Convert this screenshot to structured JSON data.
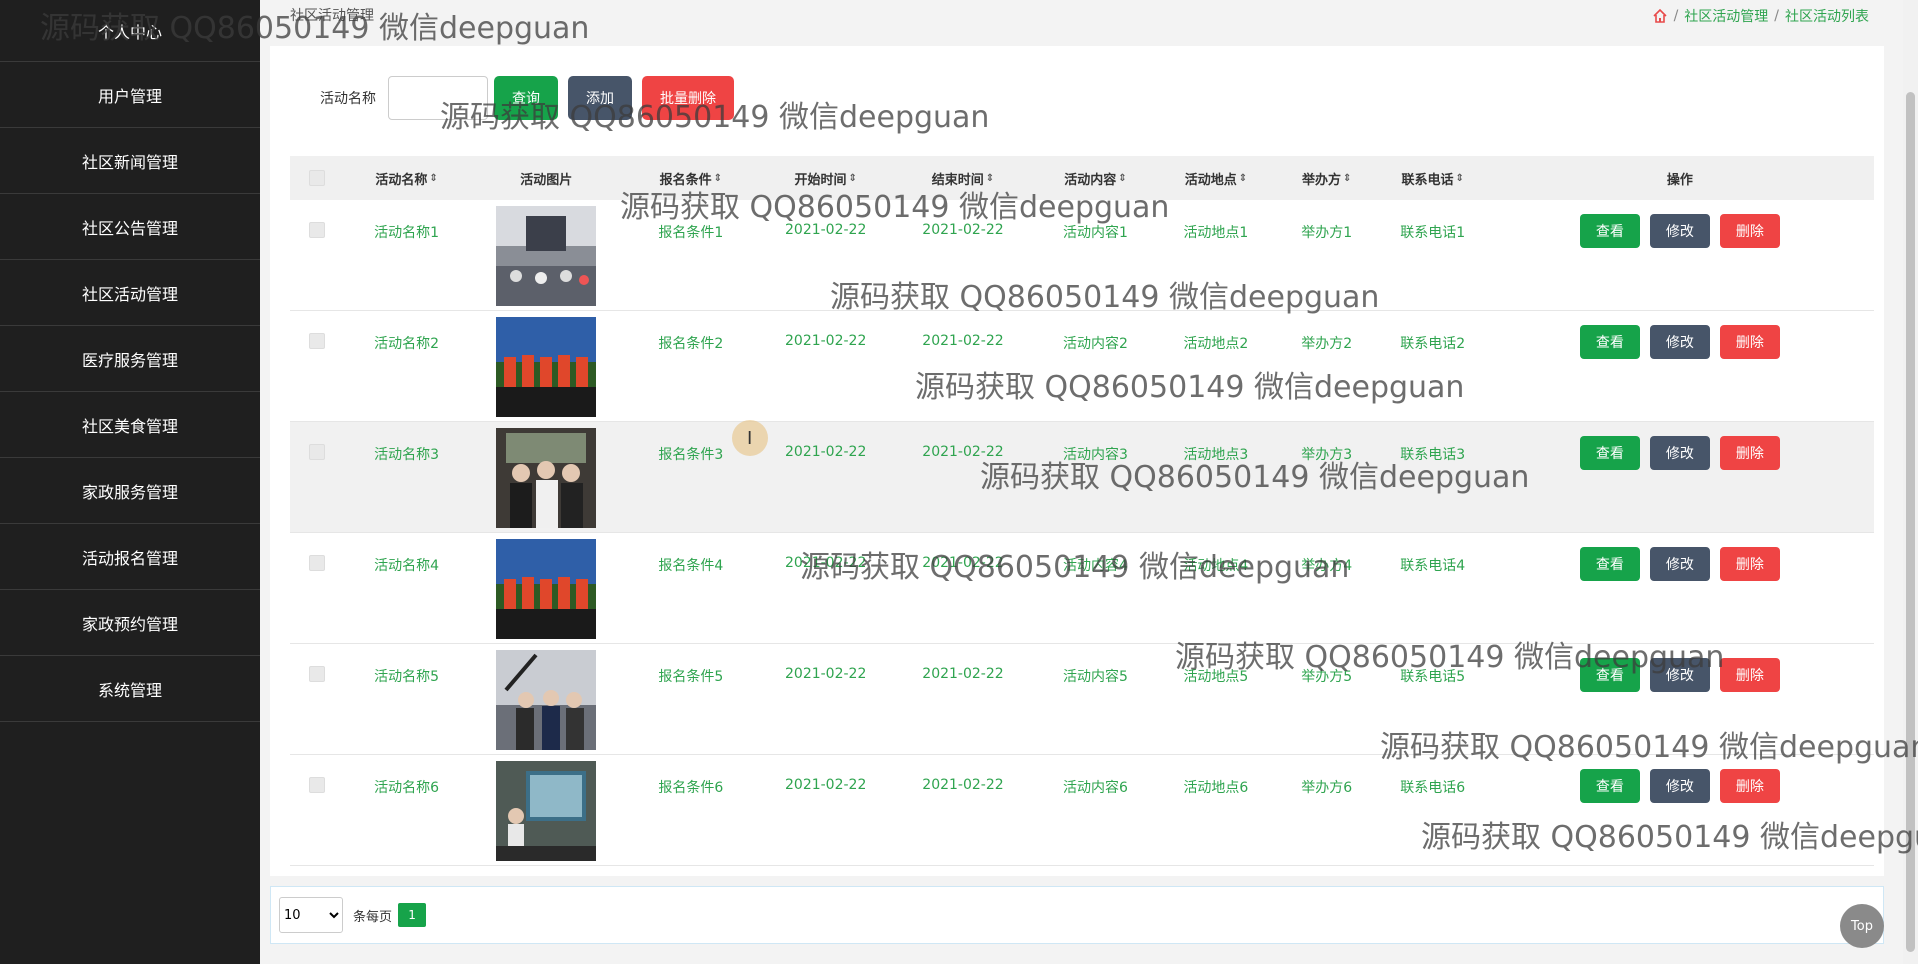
{
  "sidebar": {
    "items": [
      {
        "label": "个人中心"
      },
      {
        "label": "用户管理"
      },
      {
        "label": "社区新闻管理"
      },
      {
        "label": "社区公告管理"
      },
      {
        "label": "社区活动管理"
      },
      {
        "label": "医疗服务管理"
      },
      {
        "label": "社区美食管理"
      },
      {
        "label": "家政服务管理"
      },
      {
        "label": "活动报名管理"
      },
      {
        "label": "家政预约管理"
      },
      {
        "label": "系统管理"
      }
    ]
  },
  "header": {
    "title": "社区活动管理",
    "breadcrumb": [
      "社区活动管理",
      "社区活动列表"
    ],
    "breadcrumb_sep": "/"
  },
  "search": {
    "label": "活动名称",
    "value": "",
    "query_btn": "查询",
    "add_btn": "添加",
    "batch_delete_btn": "批量删除"
  },
  "table": {
    "columns": [
      "活动名称",
      "活动图片",
      "报名条件",
      "开始时间",
      "结束时间",
      "活动内容",
      "活动地点",
      "举办方",
      "联系电话",
      "操作"
    ],
    "sort_icon": "⇕",
    "rows": [
      {
        "name": "活动名称1",
        "cond": "报名条件1",
        "start": "2021-02-22",
        "end": "2021-02-22",
        "content": "活动内容1",
        "place": "活动地点1",
        "org": "举办方1",
        "phone": "联系电话1"
      },
      {
        "name": "活动名称2",
        "cond": "报名条件2",
        "start": "2021-02-22",
        "end": "2021-02-22",
        "content": "活动内容2",
        "place": "活动地点2",
        "org": "举办方2",
        "phone": "联系电话2"
      },
      {
        "name": "活动名称3",
        "cond": "报名条件3",
        "start": "2021-02-22",
        "end": "2021-02-22",
        "content": "活动内容3",
        "place": "活动地点3",
        "org": "举办方3",
        "phone": "联系电话3"
      },
      {
        "name": "活动名称4",
        "cond": "报名条件4",
        "start": "2021-02-22",
        "end": "2021-02-22",
        "content": "活动内容4",
        "place": "活动地点4",
        "org": "举办方4",
        "phone": "联系电话4"
      },
      {
        "name": "活动名称5",
        "cond": "报名条件5",
        "start": "2021-02-22",
        "end": "2021-02-22",
        "content": "活动内容5",
        "place": "活动地点5",
        "org": "举办方5",
        "phone": "联系电话5"
      },
      {
        "name": "活动名称6",
        "cond": "报名条件6",
        "start": "2021-02-22",
        "end": "2021-02-22",
        "content": "活动内容6",
        "place": "活动地点6",
        "org": "举办方6",
        "phone": "联系电话6"
      }
    ],
    "ops": {
      "view": "查看",
      "edit": "修改",
      "delete": "删除"
    }
  },
  "pager": {
    "page_size": "10",
    "per_page_label": "条每页",
    "current_page": "1"
  },
  "top_button": "Top",
  "watermark": "源码获取 QQ86050149 微信deepguan",
  "colors": {
    "sidebar_bg": "#1f1f1f",
    "green": "#16a34a",
    "gray": "#475569",
    "red": "#ef4444",
    "link_green": "#2fa44f"
  }
}
